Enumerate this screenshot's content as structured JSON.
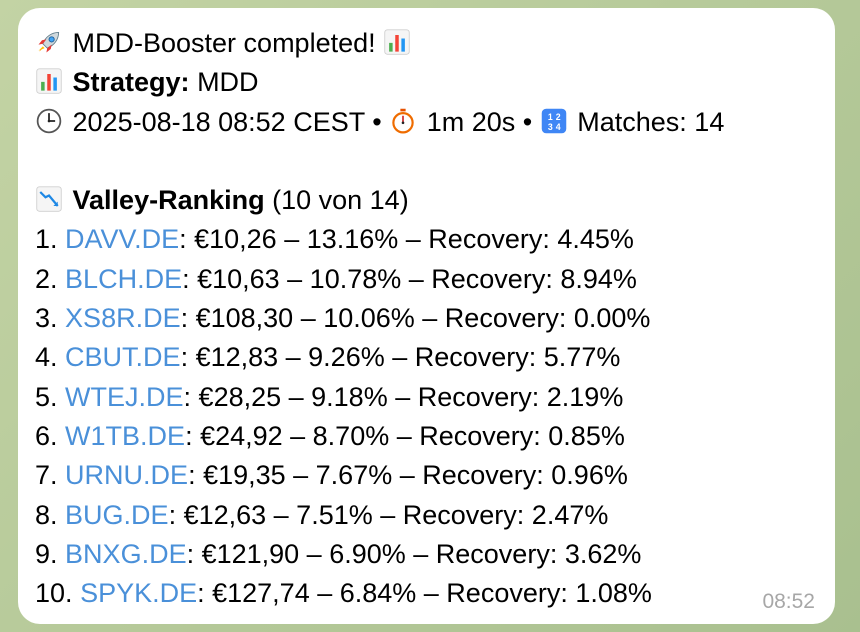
{
  "message": {
    "title": "MDD-Booster completed!",
    "strategy_label": "Strategy:",
    "strategy_value": "MDD",
    "datetime": "2025-08-18 08:52 CEST",
    "separator": "•",
    "duration": "1m 20s",
    "matches": "Matches: 14",
    "ranking_title": "Valley-Ranking",
    "ranking_count": "(10 von 14)",
    "timestamp": "08:52",
    "ranking": [
      {
        "index": "1.",
        "ticker": "DAVV.DE",
        "details": ": €10,26 – 13.16% – Recovery: 4.45%"
      },
      {
        "index": "2.",
        "ticker": "BLCH.DE",
        "details": ": €10,63 – 10.78% – Recovery: 8.94%"
      },
      {
        "index": "3.",
        "ticker": "XS8R.DE",
        "details": ": €108,30 – 10.06% – Recovery: 0.00%"
      },
      {
        "index": "4.",
        "ticker": "CBUT.DE",
        "details": ": €12,83 – 9.26% – Recovery: 5.77%"
      },
      {
        "index": "5.",
        "ticker": "WTEJ.DE",
        "details": ": €28,25 – 9.18% – Recovery: 2.19%"
      },
      {
        "index": "6.",
        "ticker": "W1TB.DE",
        "details": ": €24,92 – 8.70% – Recovery: 0.85%"
      },
      {
        "index": "7.",
        "ticker": "URNU.DE",
        "details": ": €19,35 – 7.67% – Recovery: 0.96%"
      },
      {
        "index": "8.",
        "ticker": "BUG.DE",
        "details": ": €12,63 – 7.51% – Recovery: 2.47%"
      },
      {
        "index": "9.",
        "ticker": "BNXG.DE",
        "details": ": €121,90 – 6.90% – Recovery: 3.62%"
      },
      {
        "index": "10.",
        "ticker": "SPYK.DE",
        "details": ": €127,74 – 6.84% – Recovery: 1.08%"
      }
    ]
  },
  "icons": {
    "title_left": "rocket-icon",
    "title_right": "bar-chart-icon",
    "strategy": "bar-chart-icon",
    "datetime": "clock-icon",
    "duration": "stopwatch-icon",
    "matches": "numbers-icon",
    "ranking": "chart-decreasing-icon"
  },
  "colors": {
    "link": "#4a90d9",
    "timestamp": "#a7a7a7",
    "bubble": "#ffffff"
  }
}
